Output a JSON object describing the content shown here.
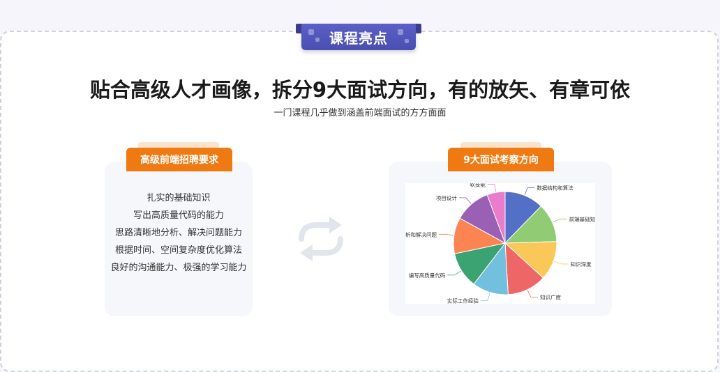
{
  "badge": {
    "label": "课程亮点"
  },
  "headline": {
    "title": "贴合高级人才画像，拆分9大面试方向，有的放矢、有章可依",
    "subtitle": "一门课程几乎做到涵盖前端面试的方方面面"
  },
  "requirements": {
    "tab_label": "高级前端招聘要求",
    "items": [
      "扎实的基础知识",
      "写出高质量代码的能力",
      "思路清晰地分析、解决问题能力",
      "根据时间、空间复杂度优化算法",
      "良好的沟通能力、极强的学习能力"
    ]
  },
  "swap_icon": "swap-arrows-icon",
  "directions": {
    "tab_label": "9大面试考察方向",
    "chart_data": {
      "type": "pie",
      "categories": [
        "数据结构和算法",
        "前端基础知识",
        "知识深度",
        "知识广度",
        "实际工作经验",
        "编写高质量代码",
        "分析和解决问题",
        "项目设计",
        "软技能"
      ],
      "values": [
        13,
        13,
        13,
        13,
        12,
        12,
        12,
        12,
        6
      ],
      "colors": [
        "#5470c6",
        "#91cc75",
        "#fac858",
        "#ee6666",
        "#73c0de",
        "#3ba272",
        "#fc8452",
        "#9a60b4",
        "#ea7ccc"
      ]
    }
  },
  "colors": {
    "accent": "#f07a12",
    "badge": "#4a4fb0"
  }
}
